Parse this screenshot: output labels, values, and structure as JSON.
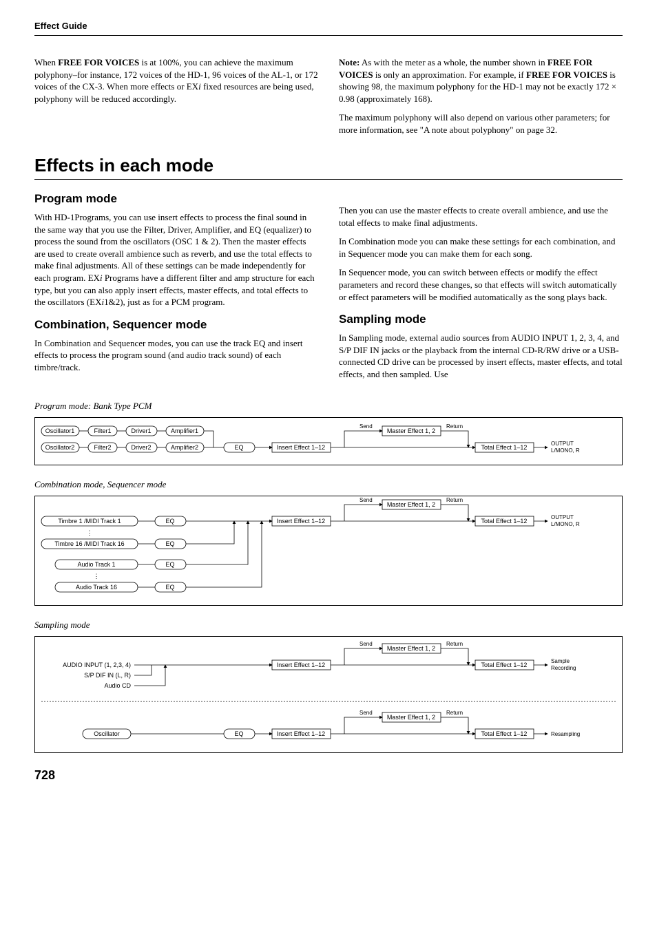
{
  "header": {
    "section": "Effect Guide"
  },
  "intro": {
    "col1": {
      "p1a": "When ",
      "p1b": "FREE FOR VOICES",
      "p1c": " is at 100%, you can achieve the maximum polyphony–for instance, 172 voices of the HD-1, 96 voices of the AL-1, or 172 voices of the CX-3. When more effects or EX",
      "p1d": "i",
      "p1e": " fixed resources are being used, polyphony will be reduced accordingly."
    },
    "col2": {
      "p1a": "Note:",
      "p1b": " As with the meter as a whole, the number shown in ",
      "p1c": "FREE FOR VOICES",
      "p1d": " is only an approximation. For example, if ",
      "p1e": "FREE FOR VOICES",
      "p1f": " is showing 98, the maximum polyphony for the HD-1 may not be exactly 172 × 0.98 (approximately 168).",
      "p2": "The maximum polyphony will also depend on various other parameters; for more information, see \"A note about polyphony\" on page 32."
    }
  },
  "h1": "Effects in each mode",
  "program": {
    "title": "Program mode",
    "p1a": "With HD-1Programs, you can use insert effects to process the final sound in the same way that you use the Filter, Driver, Amplifier, and EQ (equalizer) to process the sound from the oscillators (OSC 1 & 2). Then the master effects are used to create overall ambience such as reverb, and use the total effects to make final adjustments. All of these settings can be made independently for each program. EX",
    "p1b": "i",
    "p1c": " Programs have a different filter and amp structure for each type, but you can also apply insert effects, master effects, and total effects to the oscillators (EX",
    "p1d": "i",
    "p1e": "1&2), just as for a PCM program."
  },
  "combi": {
    "title": "Combination, Sequencer mode",
    "p1": "In Combination and Sequencer modes, you can use the track EQ and insert effects to process the program sound (and audio track sound) of each timbre/track."
  },
  "col2b": {
    "p1": "Then you can use the master effects to create overall ambience, and use the total effects to make final adjustments.",
    "p2": "In Combination mode you can make these settings for each combination, and in Sequencer mode you can make them for each song.",
    "p3": "In Sequencer mode, you can switch between effects or modify the effect parameters and record these changes, so that effects will switch automatically or effect parameters will be modified automatically as the song plays back."
  },
  "sampling": {
    "title": "Sampling mode",
    "p1": "In Sampling mode, external audio sources from AUDIO INPUT 1, 2, 3, 4, and S/P DIF IN jacks or the playback from the internal CD-R/RW drive or a USB-connected CD drive can be processed by insert effects, master effects, and total effects, and then sampled. Use"
  },
  "diagrams": {
    "d1_caption": "Program mode: Bank Type PCM",
    "d2_caption": "Combination mode, Sequencer mode",
    "d3_caption": "Sampling mode",
    "labels": {
      "osc1": "Oscillator1",
      "osc2": "Oscillator2",
      "osc": "Oscillator",
      "flt1": "Filter1",
      "flt2": "Filter2",
      "drv1": "Driver1",
      "drv2": "Driver2",
      "amp1": "Amplifier1",
      "amp2": "Amplifier2",
      "eq": "EQ",
      "ifx": "Insert Effect 1–12",
      "send": "Send",
      "mfx": "Master Effect 1, 2",
      "return": "Return",
      "tfx": "Total Effect 1–12",
      "out": "OUTPUT",
      "out2": "L/MONO, R",
      "timbre1": "Timbre 1 /MIDI Track 1",
      "timbre16": "Timbre 16 /MIDI Track 16",
      "atrack1": "Audio Track 1",
      "atrack16": "Audio Track 16",
      "ainput": "AUDIO INPUT (1, 2,3, 4)",
      "spdif": "S/P DIF IN (L, R)",
      "audiocd": "Audio CD",
      "sample": "Sample",
      "recording": "Recording",
      "resampling": "Resampling"
    }
  },
  "page": "728"
}
